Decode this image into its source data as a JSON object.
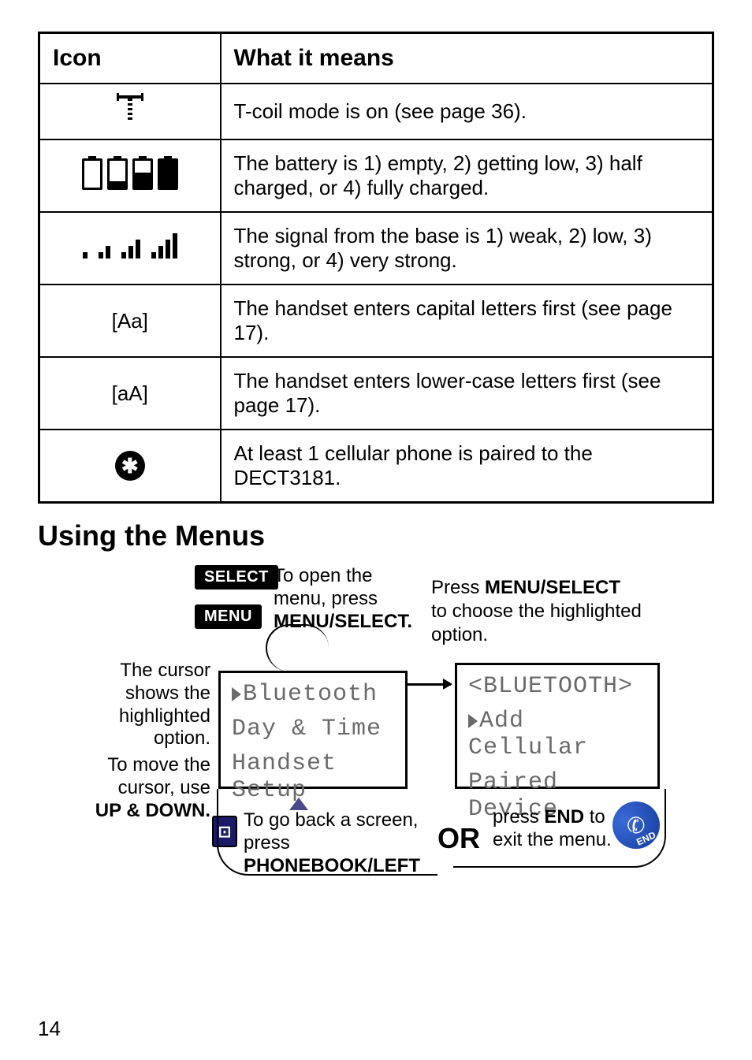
{
  "table": {
    "headers": {
      "icon": "Icon",
      "means": "What it means"
    },
    "rows": {
      "tcoil": {
        "desc": "T-coil mode is on (see page 36)."
      },
      "battery": {
        "desc": "The battery is 1) empty, 2) getting low, 3) half charged, or 4) fully charged."
      },
      "signal": {
        "desc": "The signal from the base is 1) weak, 2) low, 3) strong, or 4) very strong."
      },
      "Aa": {
        "icon": "[Aa]",
        "desc": "The handset enters capital letters first (see page 17)."
      },
      "aA": {
        "icon": "[aA]",
        "desc": "The handset enters lower-case letters first (see page 17)."
      },
      "bt": {
        "desc": "At least 1 cellular phone is paired to the DECT3181."
      }
    }
  },
  "heading": "Using the Menus",
  "diagram": {
    "select_label": "SELECT",
    "menu_label": "MENU",
    "open_pre": "To open the menu, press",
    "open_bold": "MENU/SELECT.",
    "cursor_text": "The cursor shows the highlighted option.",
    "move_pre": "To move the cursor, use",
    "move_bold": "UP & DOWN.",
    "press_pre": "Press",
    "press_bold": "MENU/SELECT",
    "press_post": "to choose the highlighted option.",
    "screen1": {
      "l1": "Bluetooth",
      "l2": "Day & Time",
      "l3": "Handset Setup"
    },
    "screen2": {
      "l1": "<BLUETOOTH>",
      "l2": "Add Cellular",
      "l3": "Paired Device"
    },
    "back_pre": "To go back a screen, press",
    "back_bold": "PHONEBOOK/LEFT",
    "or": "OR",
    "exit_pre": "press",
    "exit_bold": "END",
    "exit_post1": "to",
    "exit_post2": "exit the menu.",
    "end_icon_label": "END",
    "pb_glyph": "⊡"
  },
  "page_number": "14",
  "bt_glyph": "✱"
}
